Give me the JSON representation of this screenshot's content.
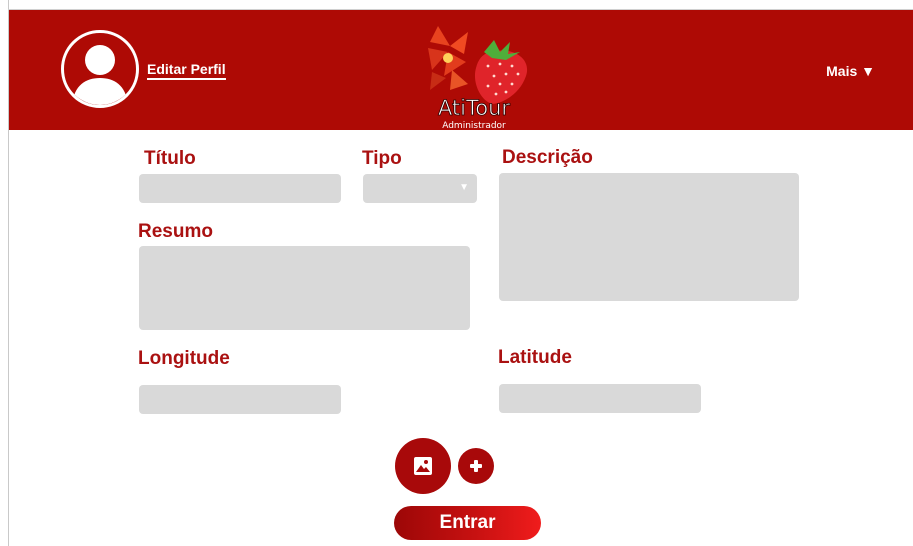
{
  "header": {
    "edit_profile_label": "Editar Perfil",
    "more_label": "Mais ▼",
    "logo": {
      "brand": "AtiTour",
      "subtitle": "Administrador"
    }
  },
  "form": {
    "titulo_label": "Título",
    "tipo_label": "Tipo",
    "descricao_label": "Descrição",
    "resumo_label": "Resumo",
    "longitude_label": "Longitude",
    "latitude_label": "Latitude",
    "titulo_value": "",
    "descricao_value": "",
    "resumo_value": "",
    "longitude_value": "",
    "latitude_value": ""
  },
  "actions": {
    "image_icon": "image-icon",
    "add_icon": "plus-icon",
    "submit_label": "Entrar"
  },
  "colors": {
    "header_bg": "#ae0a05",
    "label": "#aa1111",
    "field_bg": "#d9d9d9",
    "button": "#a8090a"
  }
}
